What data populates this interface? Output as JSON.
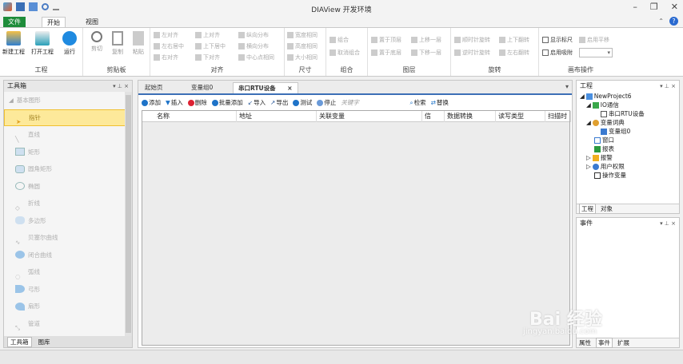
{
  "window": {
    "title": "DIAView 开发环境",
    "controls": [
      "–",
      "❐",
      "✕"
    ]
  },
  "ribbon_tabs": {
    "file": "文件",
    "start": "开始",
    "view": "视图"
  },
  "ribbon": {
    "project": {
      "label": "工程",
      "new": "新建工程",
      "open": "打开工程",
      "run": "运行"
    },
    "clipboard": {
      "label": "剪贴板",
      "cut": "剪切",
      "copy": "复制",
      "paste": "粘贴"
    },
    "align": {
      "label": "对齐",
      "left": "左对齐",
      "center_h": "左右居中",
      "right": "右对齐",
      "top": "上对齐",
      "center_v": "上下居中",
      "bottom": "下对齐",
      "dist_v": "纵向分布",
      "dist_h": "横向分布",
      "center_point": "中心点相同"
    },
    "size": {
      "label": "尺寸",
      "width": "宽度相同",
      "height": "高度相同",
      "size": "大小相同"
    },
    "group": {
      "label": "组合",
      "group": "组合",
      "ungroup": "取消组合"
    },
    "layer": {
      "label": "图层",
      "top": "置于顶层",
      "up": "上移一层",
      "bottom": "置于底层",
      "down": "下移一层"
    },
    "rotate": {
      "label": "旋转",
      "cw": "顺时针旋转",
      "flip_v": "上下翻转",
      "ccw": "逆时针旋转",
      "flip_h": "左右翻转"
    },
    "canvas": {
      "label": "画布操作",
      "ruler": "显示标尺",
      "grid": "启用吸附",
      "snap": "启用平移",
      "combo_value": ""
    }
  },
  "toolbox": {
    "title": "工具箱",
    "pin": "▾ ⊥ ×",
    "section": "基本图形",
    "items": [
      "指针",
      "直线",
      "矩形",
      "圆角矩形",
      "椭圆",
      "折线",
      "多边形",
      "贝塞尔曲线",
      "闭合曲线",
      "弧线",
      "弓形",
      "扇形",
      "管道"
    ],
    "bottom_tabs": [
      "工具箱",
      "图库"
    ]
  },
  "doc": {
    "tabs": [
      "起始页",
      "变量组0",
      "串口RTU设备"
    ],
    "active_close": "×",
    "dropdown": "▾",
    "toolbar": {
      "add": "添加",
      "insert": "插入",
      "delete": "删除",
      "batch_add": "批量添加",
      "import": "导入",
      "export": "导出",
      "test": "测试",
      "stop": "停止",
      "keyword_placeholder": "关键字",
      "search": "检索",
      "replace": "替换"
    },
    "columns": [
      "名称",
      "地址",
      "关联变量",
      "信",
      "数据转换",
      "读写类型",
      "扫描时"
    ]
  },
  "project_pane": {
    "title": "工程",
    "pin": "▾ ⊥ ×",
    "tree": [
      {
        "label": "NewProject6",
        "level": 0
      },
      {
        "label": "IO通信",
        "level": 1
      },
      {
        "label": "串口RTU设备",
        "level": 2
      },
      {
        "label": "变量词典",
        "level": 1
      },
      {
        "label": "变量组0",
        "level": 2
      },
      {
        "label": "窗口",
        "level": 1
      },
      {
        "label": "报表",
        "level": 1
      },
      {
        "label": "报警",
        "level": 1
      },
      {
        "label": "用户权限",
        "level": 1
      },
      {
        "label": "操作变量",
        "level": 1
      }
    ],
    "bottom_tabs": [
      "工程",
      "对象"
    ]
  },
  "event_pane": {
    "title": "事件",
    "pin": "▾ ⊥ ×",
    "bottom_tabs": [
      "属性",
      "事件",
      "扩展"
    ]
  },
  "watermark": {
    "text": "Bai 经验",
    "url": "jingyan.baidu.com"
  }
}
